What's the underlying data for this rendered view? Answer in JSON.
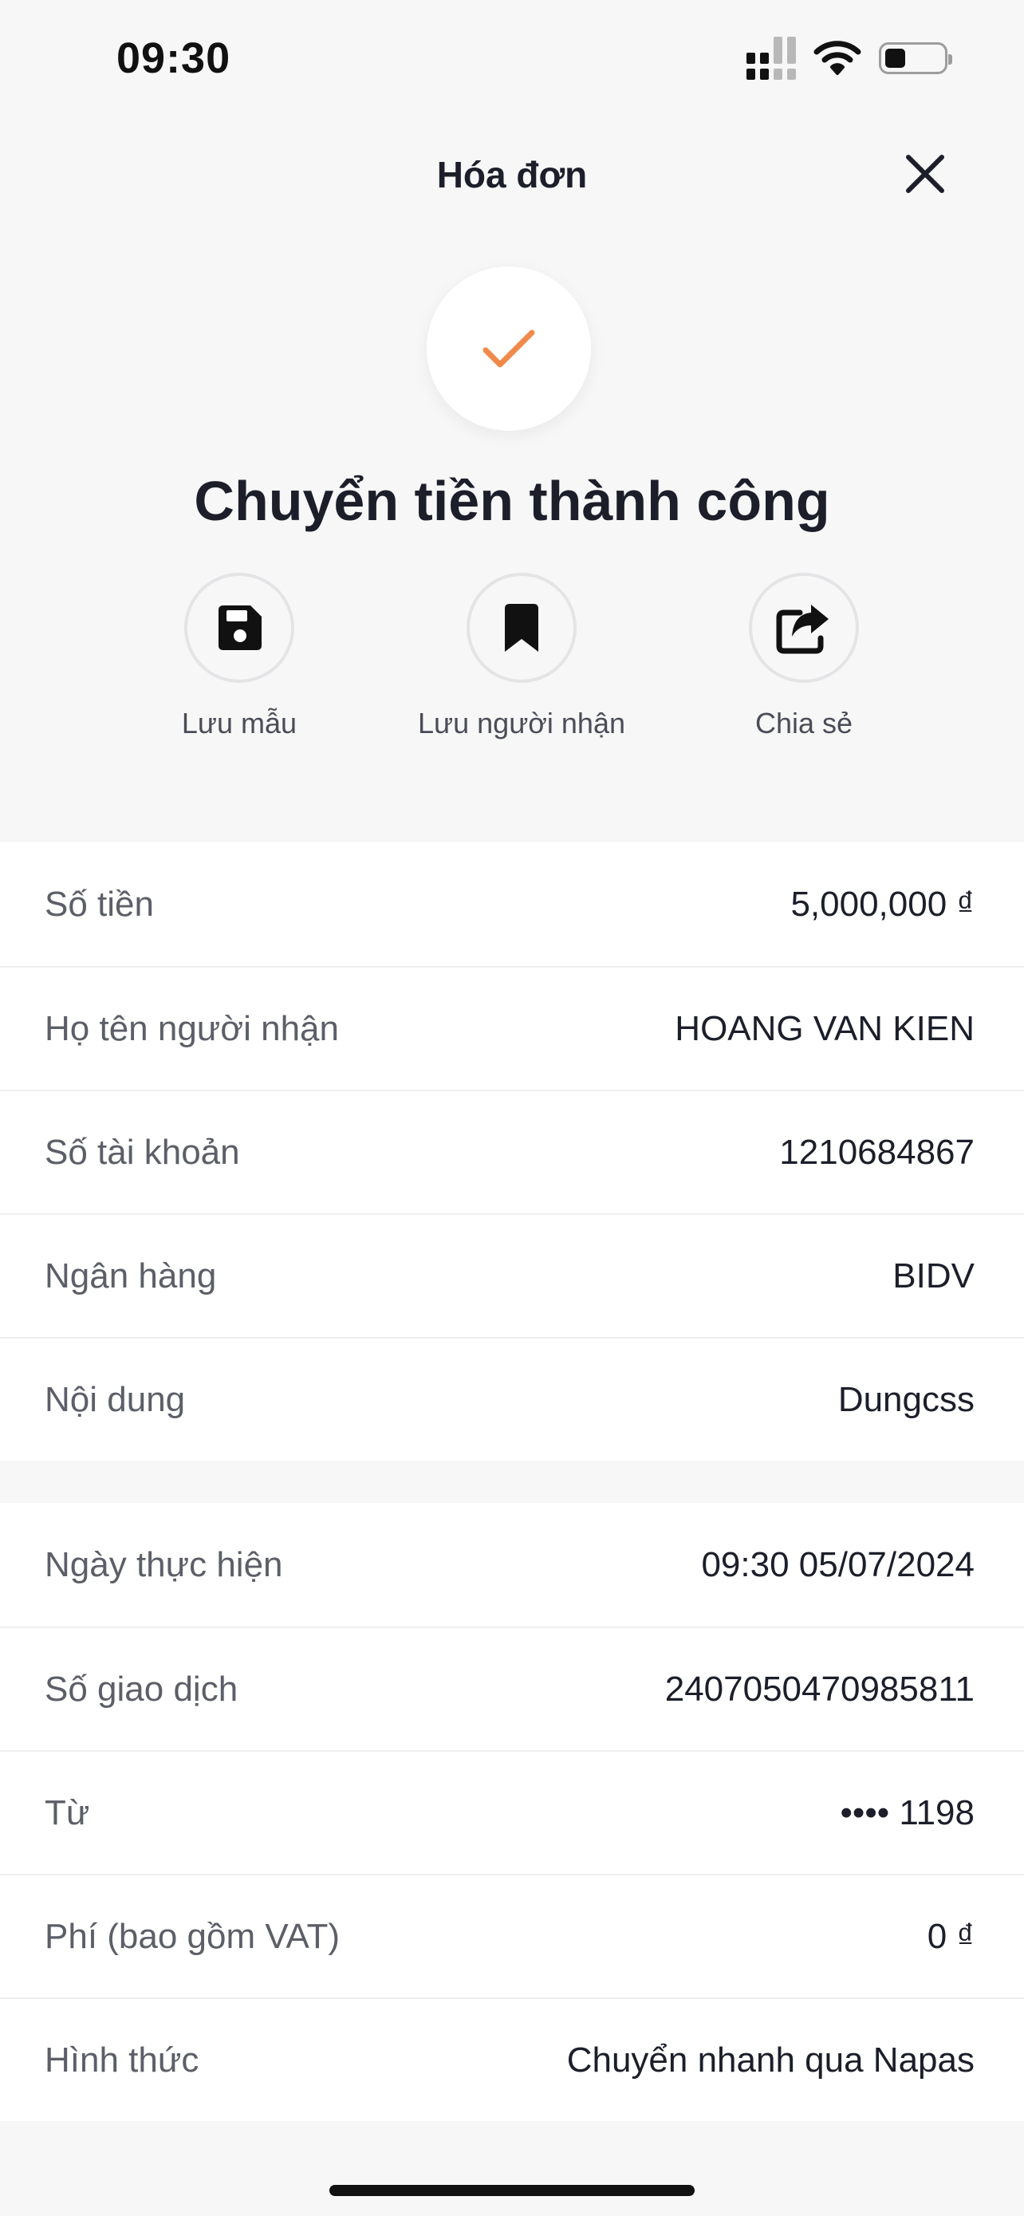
{
  "status_bar": {
    "time": "09:30",
    "battery_level": 0.35
  },
  "header": {
    "title": "Hóa đơn",
    "close_icon": "close-icon"
  },
  "success": {
    "icon": "check-icon",
    "icon_color": "#f08a4b",
    "title": "Chuyển tiền thành công"
  },
  "actions": [
    {
      "label": "Lưu mẫu",
      "icon": "floppy-disk-icon"
    },
    {
      "label": "Lưu người nhận",
      "icon": "bookmark-icon"
    },
    {
      "label": "Chia sẻ",
      "icon": "share-icon"
    }
  ],
  "details": [
    {
      "label": "Số tiền",
      "value": "5,000,000 ₫"
    },
    {
      "label": "Họ tên người nhận",
      "value": "HOANG VAN KIEN"
    },
    {
      "label": "Số tài khoản",
      "value": "1210684867"
    },
    {
      "label": "Ngân hàng",
      "value": "BIDV"
    },
    {
      "label": "Nội dung",
      "value": "Dungcss"
    }
  ],
  "transaction": [
    {
      "label": "Ngày thực hiện",
      "value": "09:30 05/07/2024"
    },
    {
      "label": "Số giao dịch",
      "value": "2407050470985811"
    },
    {
      "label": "Từ",
      "value": "•••• 1198"
    },
    {
      "label": "Phí (bao gồm VAT)",
      "value": "0 ₫"
    },
    {
      "label": "Hình thức",
      "value": "Chuyển nhanh qua Napas"
    }
  ]
}
